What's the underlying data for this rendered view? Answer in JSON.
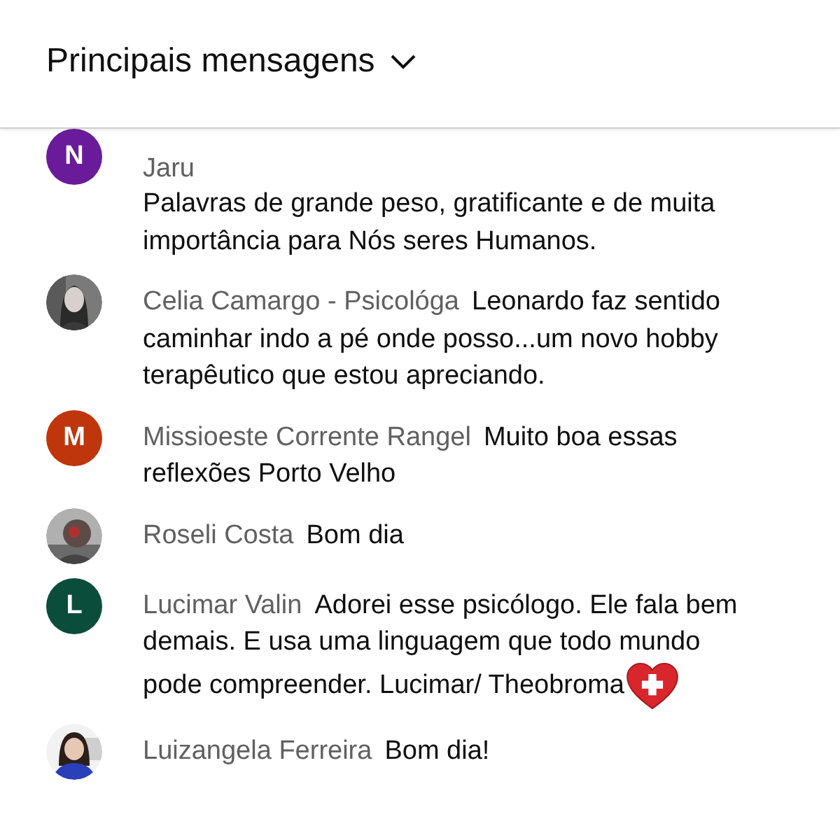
{
  "header": {
    "title": "Principais mensagens"
  },
  "comments": [
    {
      "avatar": {
        "kind": "letter",
        "letter": "N",
        "color": "#6a1b9a"
      },
      "author": "Jaru",
      "kind": "block",
      "lines": [
        "Palavras de grande peso, gratificante e de muita",
        "importância para Nós seres Humanos."
      ],
      "emoji": false
    },
    {
      "avatar": {
        "kind": "picture"
      },
      "author": "Celia Camargo - Psicológa",
      "kind": "inline",
      "lines": [
        "Leonardo faz sentido",
        "caminhar indo a pé onde posso...um novo hobby",
        "terapêutico que estou apreciando."
      ],
      "emoji": false
    },
    {
      "avatar": {
        "kind": "letter",
        "letter": "M",
        "color": "#bf360c"
      },
      "author": "Missioeste Corrente Rangel",
      "kind": "inline",
      "lines": [
        "Muito boa essas",
        "reflexões Porto Velho"
      ],
      "emoji": false
    },
    {
      "avatar": {
        "kind": "picture"
      },
      "author": "Roseli Costa",
      "kind": "inline",
      "lines": [
        "Bom dia"
      ],
      "emoji": false
    },
    {
      "avatar": {
        "kind": "letter",
        "letter": "L",
        "color": "#0b4d3b"
      },
      "author": "Lucimar Valin",
      "kind": "inline",
      "lines": [
        "Adorei esse psicólogo. Ele fala bem",
        "demais. E usa uma linguagem que todo mundo",
        "pode compreender. Lucimar/ Theobroma"
      ],
      "emoji": true
    },
    {
      "avatar": {
        "kind": "picture"
      },
      "author": "Luizangela Ferreira",
      "kind": "inline",
      "lines": [
        "Bom dia!"
      ],
      "emoji": false
    }
  ]
}
